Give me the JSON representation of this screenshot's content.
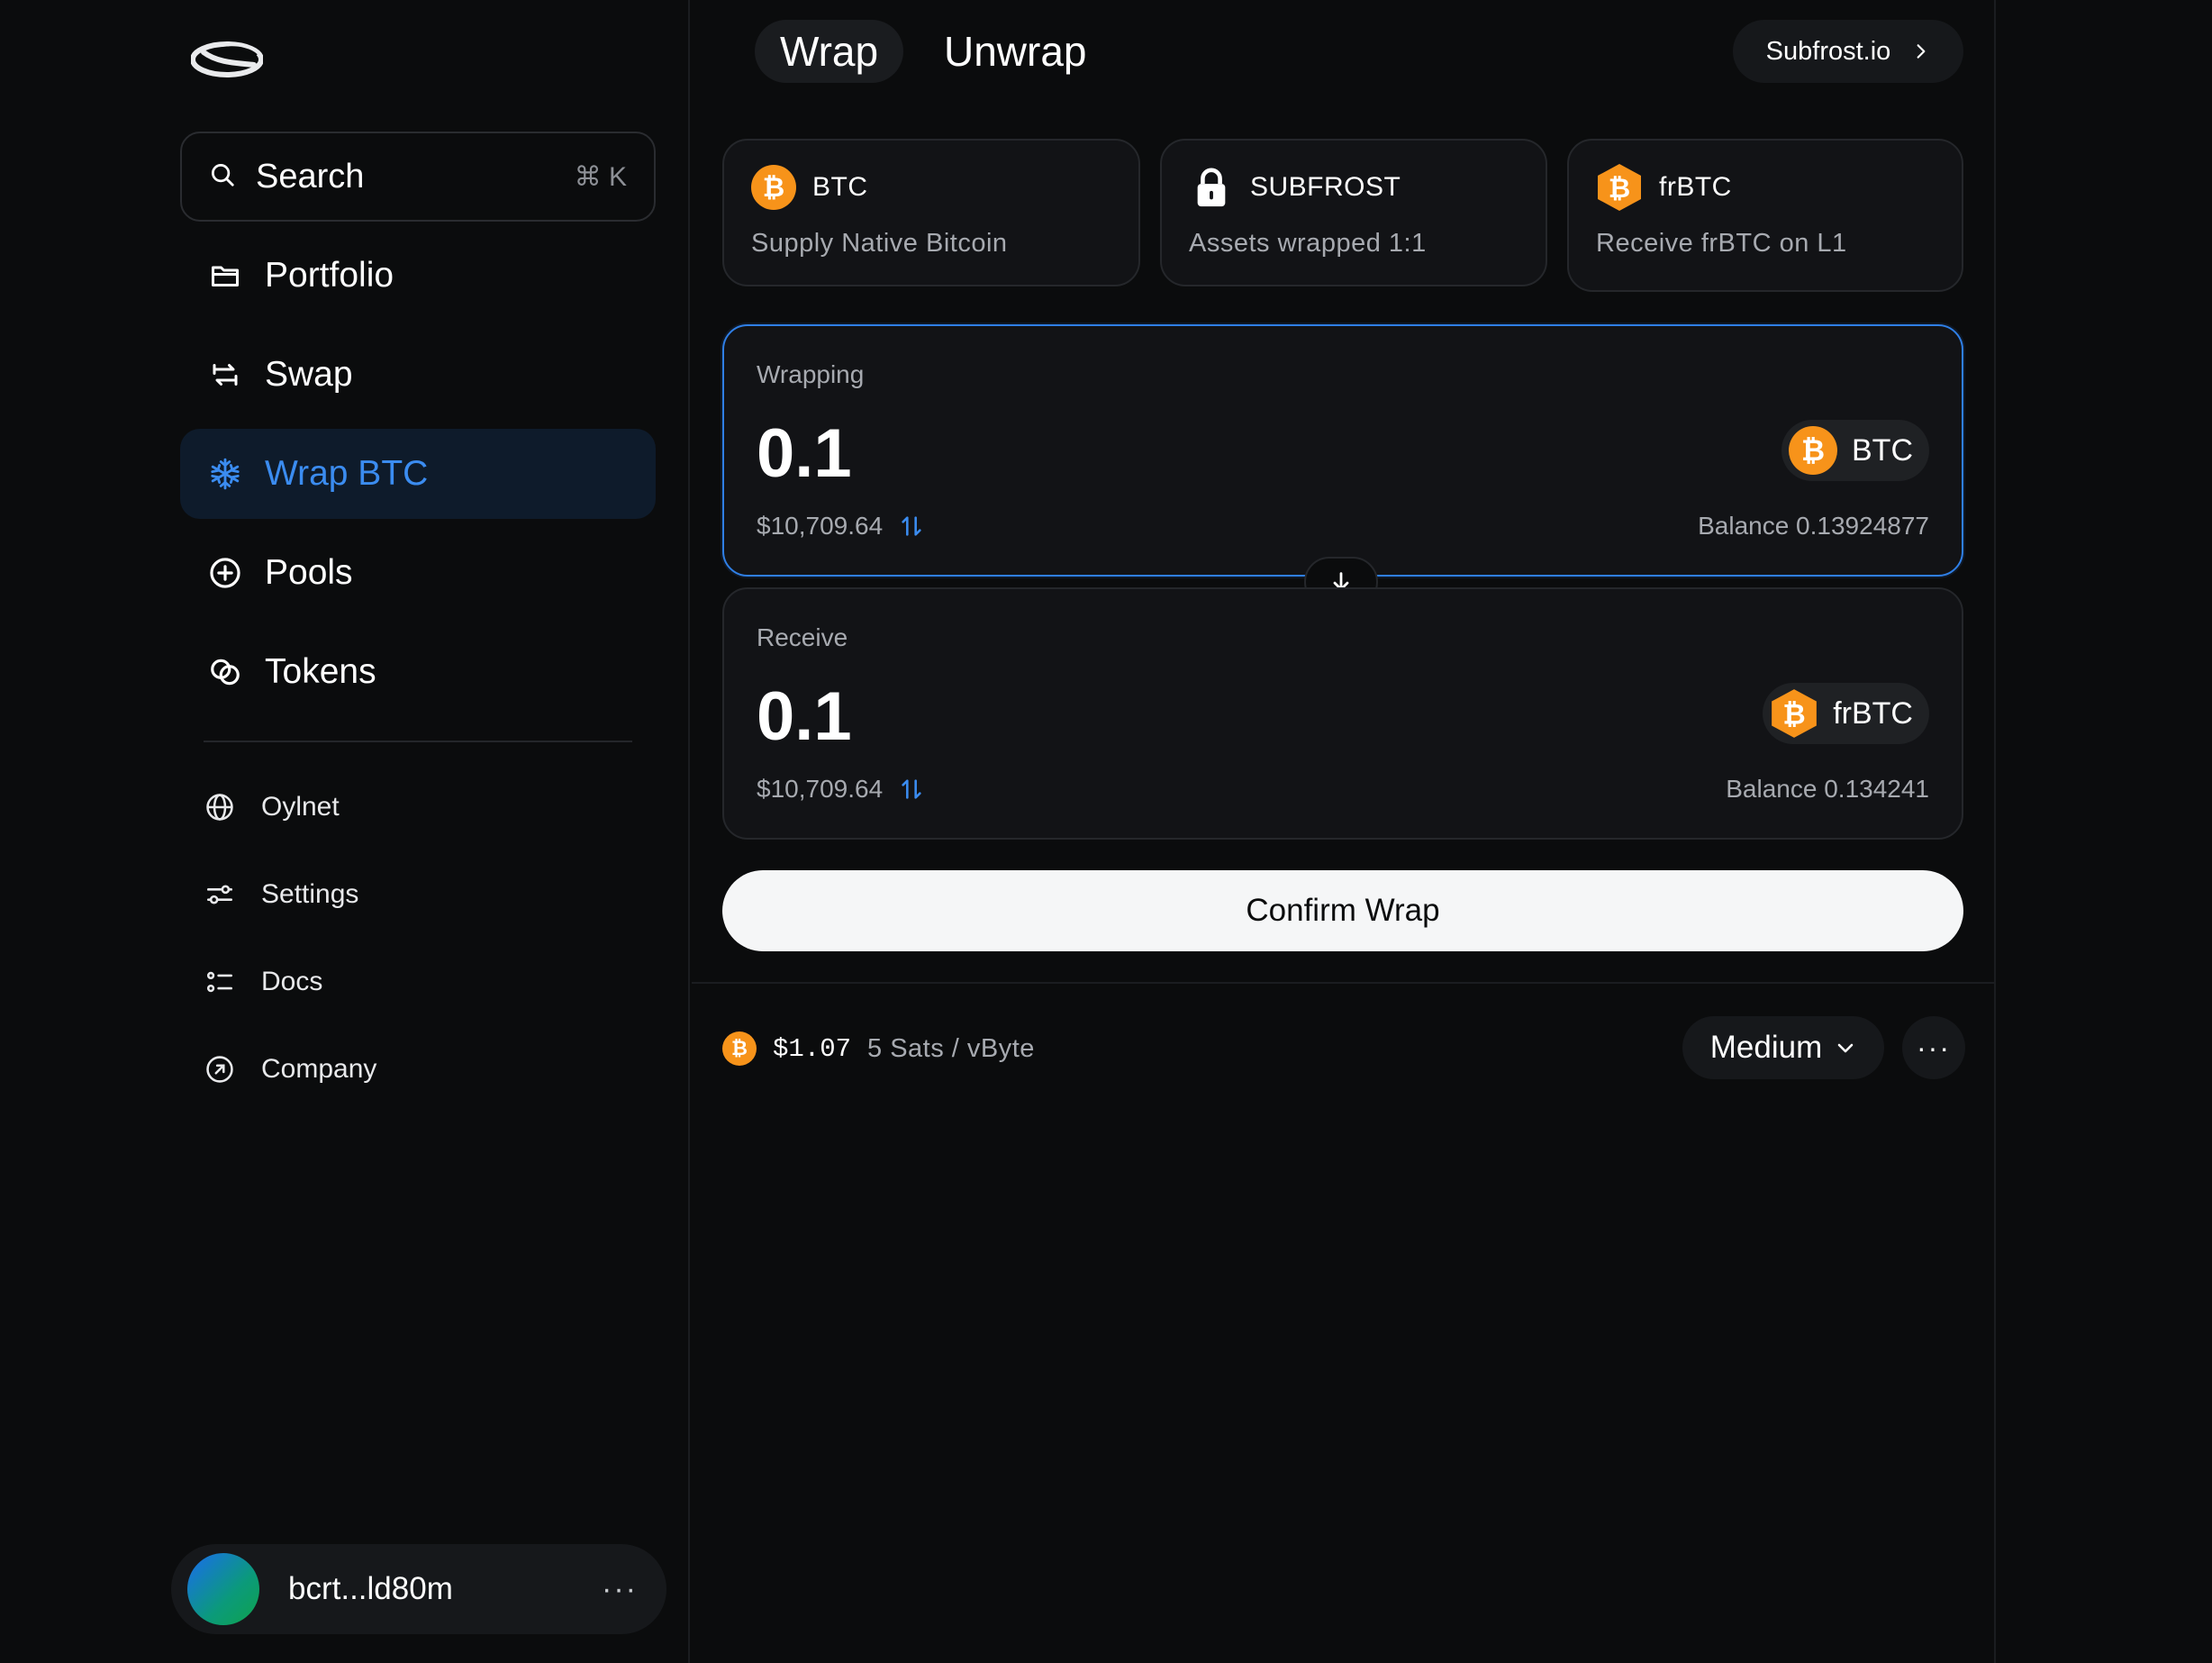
{
  "sidebar": {
    "search": {
      "label": "Search",
      "shortcut": "⌘ K"
    },
    "nav": [
      {
        "label": "Portfolio",
        "icon": "folder-icon"
      },
      {
        "label": "Swap",
        "icon": "swap-arrows-icon"
      },
      {
        "label": "Wrap BTC",
        "icon": "snowflake-icon",
        "active": true
      },
      {
        "label": "Pools",
        "icon": "plus-circle-icon"
      },
      {
        "label": "Tokens",
        "icon": "coins-icon"
      }
    ],
    "secondary": [
      {
        "label": "Oylnet",
        "icon": "globe-icon"
      },
      {
        "label": "Settings",
        "icon": "sliders-icon"
      },
      {
        "label": "Docs",
        "icon": "list-icon"
      },
      {
        "label": "Company",
        "icon": "arrow-up-right-circle-icon"
      }
    ],
    "account": {
      "address": "bcrt...ld80m",
      "more": "···"
    }
  },
  "header": {
    "tabs": [
      {
        "label": "Wrap",
        "active": true
      },
      {
        "label": "Unwrap",
        "active": false
      }
    ],
    "external_link": "Subfrost.io"
  },
  "info_cards": [
    {
      "name": "BTC",
      "desc": "Supply Native Bitcoin",
      "icon": "bitcoin-icon"
    },
    {
      "name": "SUBFROST",
      "desc": "Assets wrapped 1:1",
      "icon": "lock-icon"
    },
    {
      "name": "frBTC",
      "desc": "Receive frBTC on L1",
      "icon": "frbtc-hexagon-icon"
    }
  ],
  "wrapping": {
    "label": "Wrapping",
    "amount": "0.1",
    "usd": "$10,709.64",
    "token": "BTC",
    "balance": "Balance 0.13924877"
  },
  "receive": {
    "label": "Receive",
    "amount": "0.1",
    "usd": "$10,709.64",
    "token": "frBTC",
    "balance": "Balance 0.134241"
  },
  "confirm_label": "Confirm Wrap",
  "fee": {
    "price": "$1.07",
    "rate": "5 Sats / vByte",
    "speed": "Medium",
    "more": "···"
  },
  "colors": {
    "accent": "#3b8cf0",
    "bitcoin": "#f7931a",
    "background": "#0b0c0d",
    "card": "#121316"
  }
}
